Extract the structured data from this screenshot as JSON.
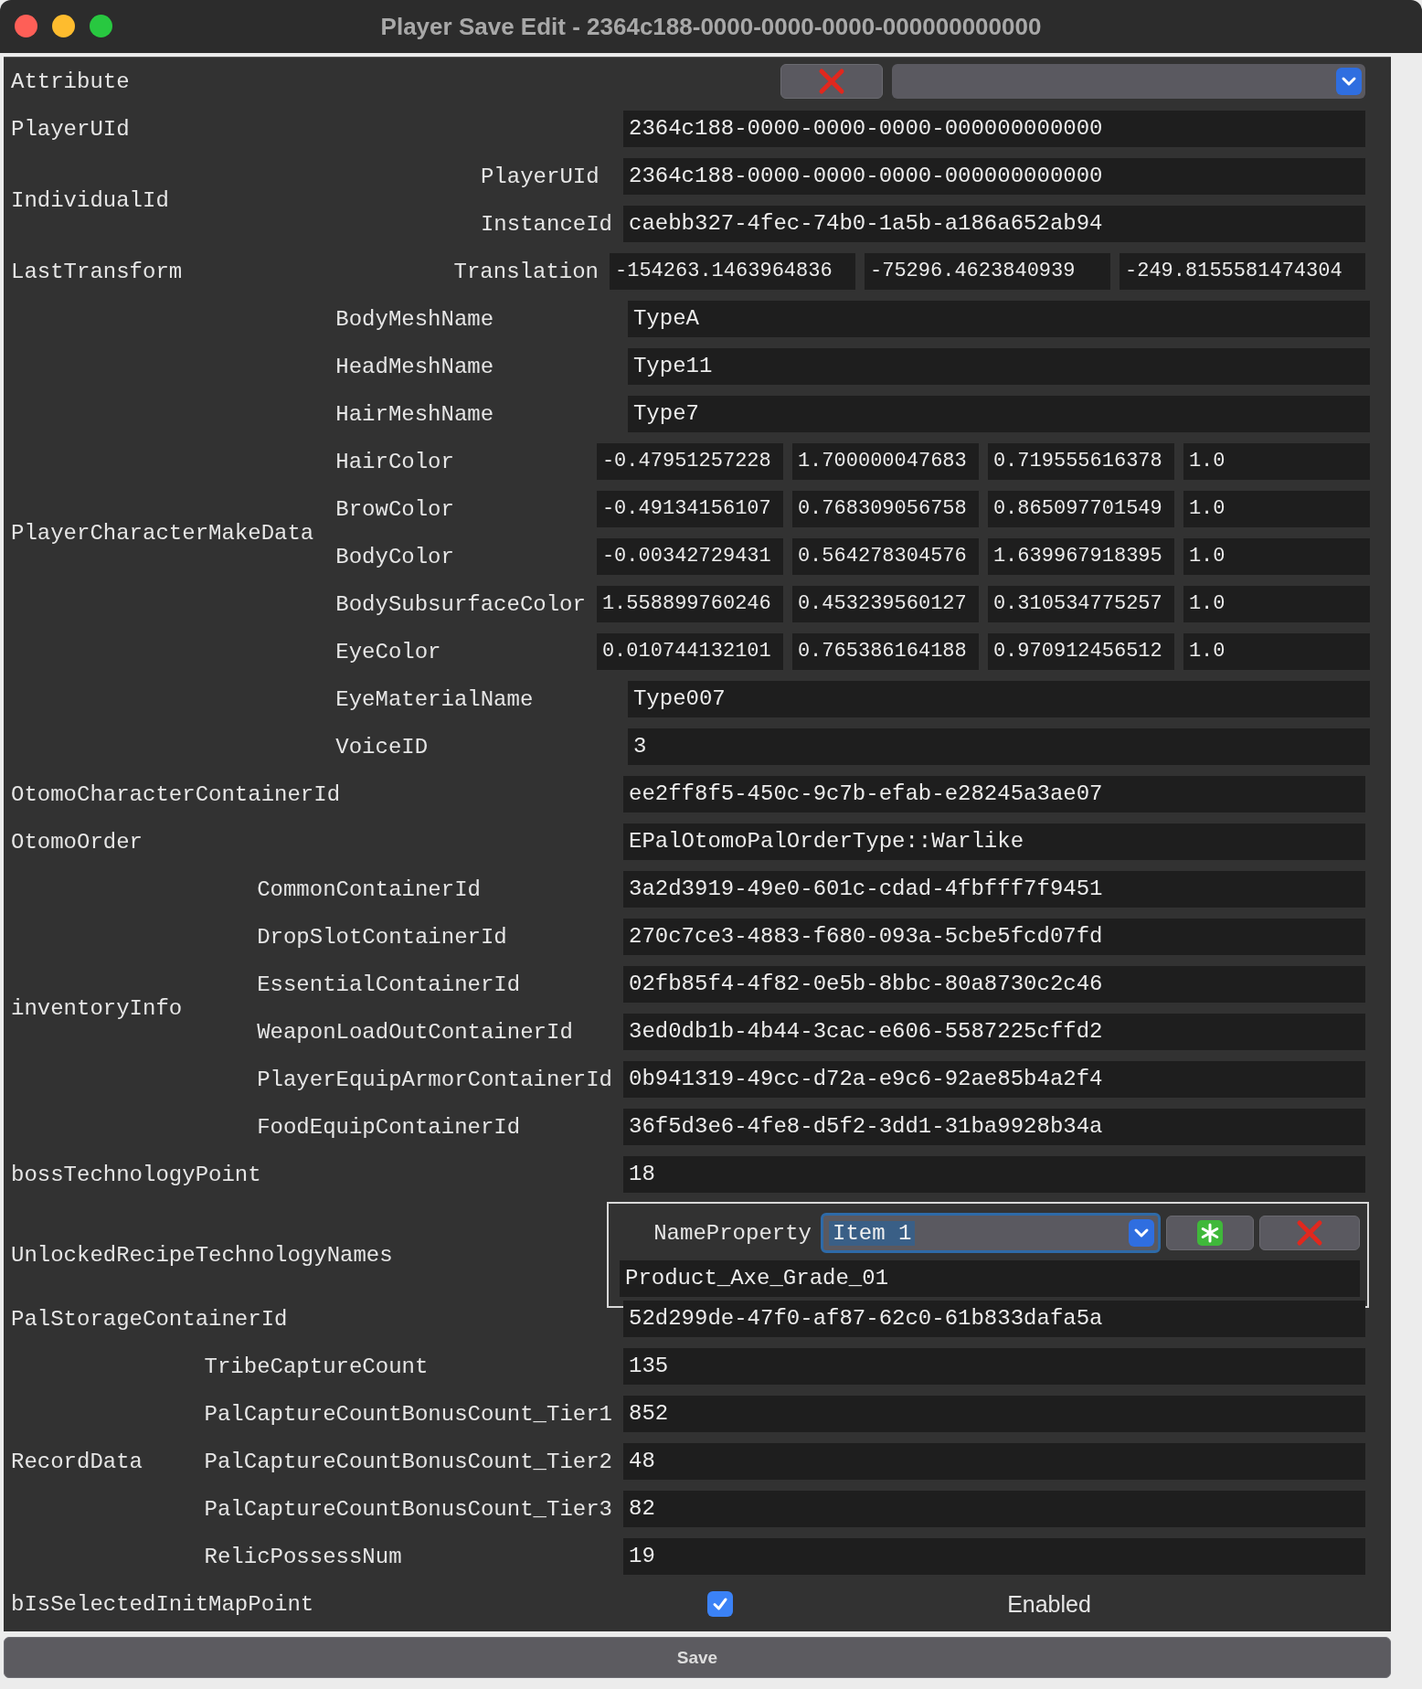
{
  "window": {
    "title": "Player Save Edit - 2364c188-0000-0000-0000-000000000000"
  },
  "rows": [
    {
      "kind": "attribute",
      "label": "Attribute"
    },
    {
      "kind": "field",
      "label": "PlayerUId",
      "value": "2364c188-0000-0000-0000-000000000000"
    },
    {
      "kind": "group",
      "label": "IndividualId",
      "fields": [
        {
          "label": "PlayerUId",
          "values": [
            "2364c188-0000-0000-0000-000000000000"
          ]
        },
        {
          "label": "InstanceId",
          "values": [
            "caebb327-4fec-74b0-1a5b-a186a652ab94"
          ]
        }
      ]
    },
    {
      "kind": "group",
      "label": "LastTransform",
      "fields": [
        {
          "label": "Translation",
          "values": [
            "-154263.1463964836",
            "-75296.4623840939",
            "-249.8155581474304"
          ]
        }
      ]
    },
    {
      "kind": "group",
      "label": "PlayerCharacterMakeData",
      "fields": [
        {
          "label": "BodyMeshName",
          "values": [
            "TypeA"
          ]
        },
        {
          "label": "HeadMeshName",
          "values": [
            "Type11"
          ]
        },
        {
          "label": "HairMeshName",
          "values": [
            "Type7"
          ]
        },
        {
          "label": "HairColor",
          "values": [
            "-0.47951257228",
            "1.700000047683",
            "0.719555616378",
            "1.0"
          ]
        },
        {
          "label": "BrowColor",
          "values": [
            "-0.49134156107",
            "0.768309056758",
            "0.865097701549",
            "1.0"
          ]
        },
        {
          "label": "BodyColor",
          "values": [
            "-0.00342729431",
            "0.564278304576",
            "1.639967918395",
            "1.0"
          ]
        },
        {
          "label": "BodySubsurfaceColor",
          "values": [
            "1.558899760246",
            "0.453239560127",
            "0.310534775257",
            "1.0"
          ]
        },
        {
          "label": "EyeColor",
          "values": [
            "0.010744132101",
            "0.765386164188",
            "0.970912456512",
            "1.0"
          ]
        },
        {
          "label": "EyeMaterialName",
          "values": [
            "Type007"
          ]
        },
        {
          "label": "VoiceID",
          "values": [
            "3"
          ]
        }
      ]
    },
    {
      "kind": "field",
      "label": "OtomoCharacterContainerId",
      "value": "ee2ff8f5-450c-9c7b-efab-e28245a3ae07"
    },
    {
      "kind": "field",
      "label": "OtomoOrder",
      "value": "EPalOtomoPalOrderType::Warlike"
    },
    {
      "kind": "group",
      "label": "inventoryInfo",
      "fields": [
        {
          "label": "CommonContainerId",
          "values": [
            "3a2d3919-49e0-601c-cdad-4fbfff7f9451"
          ]
        },
        {
          "label": "DropSlotContainerId",
          "values": [
            "270c7ce3-4883-f680-093a-5cbe5fcd07fd"
          ]
        },
        {
          "label": "EssentialContainerId",
          "values": [
            "02fb85f4-4f82-0e5b-8bbc-80a8730c2c46"
          ]
        },
        {
          "label": "WeaponLoadOutContainerId",
          "values": [
            "3ed0db1b-4b44-3cac-e606-5587225cffd2"
          ]
        },
        {
          "label": "PlayerEquipArmorContainerId",
          "values": [
            "0b941319-49cc-d72a-e9c6-92ae85b4a2f4"
          ]
        },
        {
          "label": "FoodEquipContainerId",
          "values": [
            "36f5d3e6-4fe8-d5f2-3dd1-31ba9928b34a"
          ]
        }
      ]
    },
    {
      "kind": "field",
      "label": "bossTechnologyPoint",
      "value": "18"
    },
    {
      "kind": "names",
      "label": "UnlockedRecipeTechnologyNames",
      "property_label": "NameProperty",
      "selected_item": "Item 1",
      "value": "Product_Axe_Grade_01"
    },
    {
      "kind": "field",
      "label": "PalStorageContainerId",
      "value": "52d299de-47f0-af87-62c0-61b833dafa5a"
    },
    {
      "kind": "group",
      "label": "RecordData",
      "fields": [
        {
          "label": "TribeCaptureCount",
          "values": [
            "135"
          ]
        },
        {
          "label": "PalCaptureCountBonusCount_Tier1",
          "values": [
            "852"
          ]
        },
        {
          "label": "PalCaptureCountBonusCount_Tier2",
          "values": [
            "48"
          ]
        },
        {
          "label": "PalCaptureCountBonusCount_Tier3",
          "values": [
            "82"
          ]
        },
        {
          "label": "RelicPossessNum",
          "values": [
            "19"
          ]
        }
      ]
    },
    {
      "kind": "checkbox",
      "label": "bIsSelectedInitMapPoint",
      "checked": true,
      "state_text": "Enabled"
    }
  ],
  "save_button": "Save"
}
